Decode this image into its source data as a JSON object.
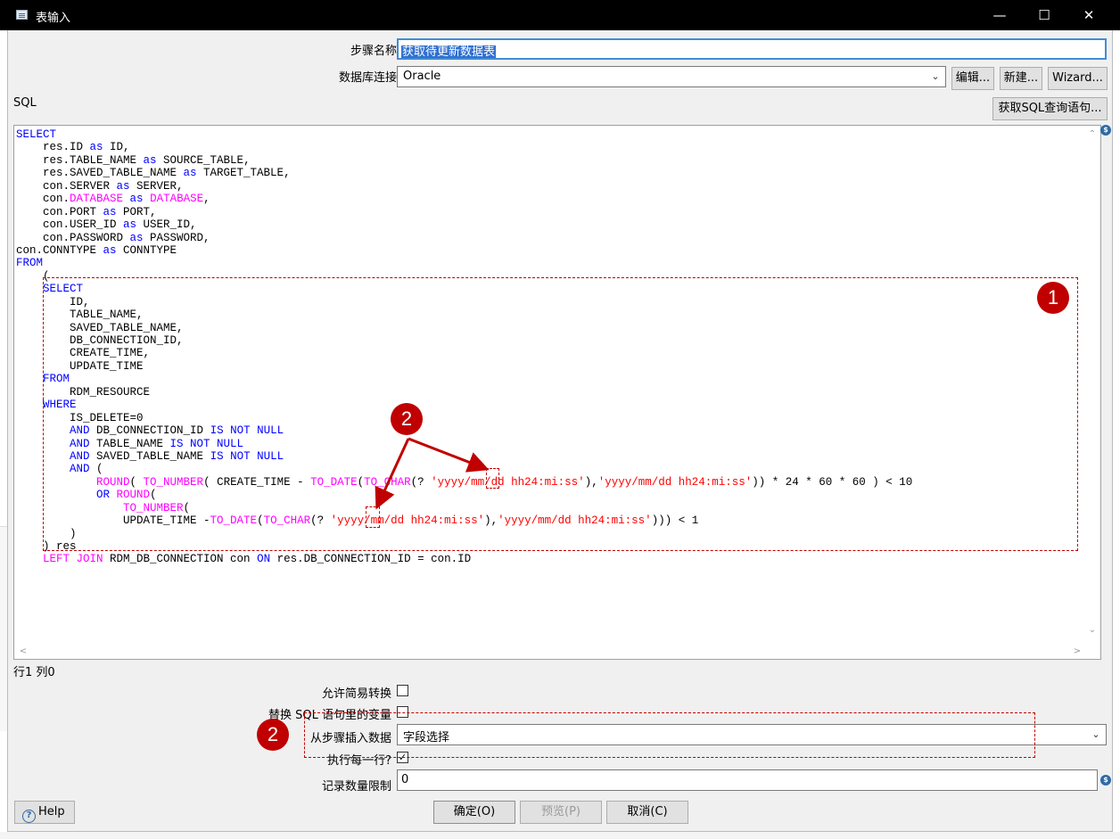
{
  "window": {
    "title": "表输入",
    "minimize": "—",
    "maximize": "☐",
    "close": "✕"
  },
  "form": {
    "step_name_label": "步骤名称",
    "step_name_value": "获取待更新数据表",
    "db_conn_label": "数据库连接",
    "db_conn_value": "Oracle",
    "edit_button": "编辑...",
    "new_button": "新建...",
    "wizard_button": "Wizard...",
    "sql_label": "SQL",
    "get_sql_button": "获取SQL查询语句...",
    "status_position": "行1 列0"
  },
  "options": {
    "lazy_conversion_label": "允许简易转换",
    "lazy_conversion_checked": false,
    "replace_vars_label": "替换 SQL 语句里的变量",
    "replace_vars_checked": false,
    "insert_from_step_label": "从步骤插入数据",
    "insert_from_step_value": "字段选择",
    "execute_each_row_label": "执行每一行?",
    "execute_each_row_checked": true,
    "limit_label": "记录数量限制",
    "limit_value": "0"
  },
  "buttons": {
    "help": "Help",
    "ok": "确定(O)",
    "preview": "预览(P)",
    "cancel": "取消(C)"
  },
  "annotations": {
    "badge1": "1",
    "badge2a": "2",
    "badge2b": "2"
  },
  "icons": {
    "help": "question-circle-icon",
    "variable": "dollar-diamond-icon",
    "dropdown": "chevron-down-icon"
  },
  "colors": {
    "keyword": "#0000ff",
    "function": "#ff00ff",
    "string": "#ff0000",
    "annotation": "#c00000"
  },
  "sql": [
    [
      {
        "t": "SELECT",
        "c": "kw"
      }
    ],
    [
      {
        "t": "    res.ID "
      },
      {
        "t": "as",
        "c": "kw"
      },
      {
        "t": " ID,"
      }
    ],
    [
      {
        "t": "    res.TABLE_NAME "
      },
      {
        "t": "as",
        "c": "kw"
      },
      {
        "t": " SOURCE_TABLE,"
      }
    ],
    [
      {
        "t": "    res.SAVED_TABLE_NAME "
      },
      {
        "t": "as",
        "c": "kw"
      },
      {
        "t": " TARGET_TABLE,"
      }
    ],
    [
      {
        "t": "    con.SERVER "
      },
      {
        "t": "as",
        "c": "kw"
      },
      {
        "t": " SERVER,"
      }
    ],
    [
      {
        "t": "    con."
      },
      {
        "t": "DATABASE",
        "c": "fn"
      },
      {
        "t": " "
      },
      {
        "t": "as",
        "c": "kw"
      },
      {
        "t": " "
      },
      {
        "t": "DATABASE",
        "c": "fn"
      },
      {
        "t": ","
      }
    ],
    [
      {
        "t": "    con.PORT "
      },
      {
        "t": "as",
        "c": "kw"
      },
      {
        "t": " PORT,"
      }
    ],
    [
      {
        "t": "    con.USER_ID "
      },
      {
        "t": "as",
        "c": "kw"
      },
      {
        "t": " USER_ID,"
      }
    ],
    [
      {
        "t": "    con.PASSWORD "
      },
      {
        "t": "as",
        "c": "kw"
      },
      {
        "t": " PASSWORD,"
      }
    ],
    [
      {
        "t": "con.CONNTYPE "
      },
      {
        "t": "as",
        "c": "kw"
      },
      {
        "t": " CONNTYPE"
      }
    ],
    [
      {
        "t": "FROM",
        "c": "kw"
      }
    ],
    [
      {
        "t": "    ("
      }
    ],
    [
      {
        "t": "    "
      },
      {
        "t": "SELECT",
        "c": "kw"
      }
    ],
    [
      {
        "t": "        ID,"
      }
    ],
    [
      {
        "t": "        TABLE_NAME,"
      }
    ],
    [
      {
        "t": "        SAVED_TABLE_NAME,"
      }
    ],
    [
      {
        "t": "        DB_CONNECTION_ID,"
      }
    ],
    [
      {
        "t": "        CREATE_TIME,"
      }
    ],
    [
      {
        "t": "        UPDATE_TIME"
      }
    ],
    [
      {
        "t": "    "
      },
      {
        "t": "FROM",
        "c": "kw"
      }
    ],
    [
      {
        "t": "        RDM_RESOURCE"
      }
    ],
    [
      {
        "t": "    "
      },
      {
        "t": "WHERE",
        "c": "kw"
      }
    ],
    [
      {
        "t": "        IS_DELETE=0"
      }
    ],
    [
      {
        "t": "        "
      },
      {
        "t": "AND",
        "c": "kw"
      },
      {
        "t": " DB_CONNECTION_ID "
      },
      {
        "t": "IS NOT NULL",
        "c": "kw"
      }
    ],
    [
      {
        "t": "        "
      },
      {
        "t": "AND",
        "c": "kw"
      },
      {
        "t": " TABLE_NAME "
      },
      {
        "t": "IS NOT NULL",
        "c": "kw"
      }
    ],
    [
      {
        "t": "        "
      },
      {
        "t": "AND",
        "c": "kw"
      },
      {
        "t": " SAVED_TABLE_NAME "
      },
      {
        "t": "IS NOT NULL",
        "c": "kw"
      }
    ],
    [
      {
        "t": "        "
      },
      {
        "t": "AND",
        "c": "kw"
      },
      {
        "t": " ("
      }
    ],
    [
      {
        "t": "            "
      },
      {
        "t": "ROUND",
        "c": "fn"
      },
      {
        "t": "( "
      },
      {
        "t": "TO_NUMBER",
        "c": "fn"
      },
      {
        "t": "( CREATE_TIME - "
      },
      {
        "t": "TO_DATE",
        "c": "fn"
      },
      {
        "t": "("
      },
      {
        "t": "TO_CHAR",
        "c": "fn"
      },
      {
        "t": "(? "
      },
      {
        "t": "'yyyy/mm/dd hh24:mi:ss'",
        "c": "st"
      },
      {
        "t": "),"
      },
      {
        "t": "'yyyy/mm/dd hh24:mi:ss'",
        "c": "st"
      },
      {
        "t": ")) * 24 * 60 * 60 ) < 10"
      }
    ],
    [
      {
        "t": "            "
      },
      {
        "t": "OR",
        "c": "kw"
      },
      {
        "t": " "
      },
      {
        "t": "ROUND",
        "c": "fn"
      },
      {
        "t": "("
      }
    ],
    [
      {
        "t": "                "
      },
      {
        "t": "TO_NUMBER",
        "c": "fn"
      },
      {
        "t": "("
      }
    ],
    [
      {
        "t": "                UPDATE_TIME -"
      },
      {
        "t": "TO_DATE",
        "c": "fn"
      },
      {
        "t": "("
      },
      {
        "t": "TO_CHAR",
        "c": "fn"
      },
      {
        "t": "(? "
      },
      {
        "t": "'yyyy/mm/dd hh24:mi:ss'",
        "c": "st"
      },
      {
        "t": "),"
      },
      {
        "t": "'yyyy/mm/dd hh24:mi:ss'",
        "c": "st"
      },
      {
        "t": "))) < 1"
      }
    ],
    [
      {
        "t": "        )"
      }
    ],
    [
      {
        "t": "    ) res"
      }
    ],
    [
      {
        "t": "    "
      },
      {
        "t": "LEFT JOIN",
        "c": "fn"
      },
      {
        "t": " RDM_DB_CONNECTION con "
      },
      {
        "t": "ON",
        "c": "kw"
      },
      {
        "t": " res.DB_CONNECTION_ID = con.ID"
      }
    ]
  ]
}
